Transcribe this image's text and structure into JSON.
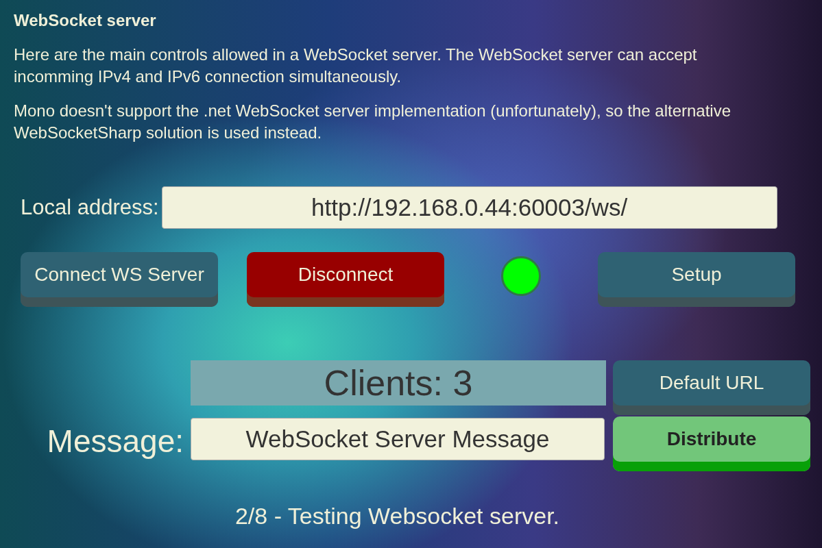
{
  "title": "WebSocket server",
  "paragraphs": [
    "Here are the main controls allowed in a WebSocket server. The WebSocket server can accept incomming IPv4 and IPv6 connection simultaneously.",
    "Mono doesn't support the .net WebSocket server implementation (unfortunately), so the alternative WebSocketSharp solution is used instead."
  ],
  "address": {
    "label": "Local address:",
    "value": "http://192.168.0.44:60003/ws/"
  },
  "buttons": [
    {
      "label": "Connect WS Server",
      "kind": "default"
    },
    {
      "label": "Disconnect",
      "kind": "danger"
    },
    {
      "label": "Setup",
      "kind": "default"
    }
  ],
  "status": {
    "color": "#00ff00"
  },
  "clients": "Clients: 3",
  "default_url": {
    "label": "Default URL",
    "kind": "default"
  },
  "message": {
    "label": "Message:",
    "value": "WebSocket Server Message"
  },
  "distribute": {
    "label": "Distribute",
    "kind": "primary"
  },
  "footer": "2/8 - Testing Websocket server."
}
